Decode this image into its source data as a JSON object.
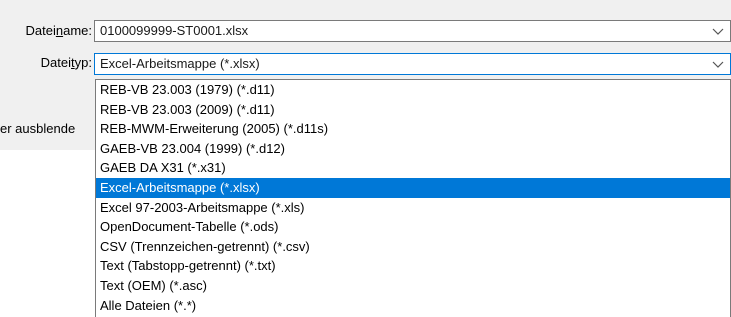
{
  "filename": {
    "label_prefix": "Datei",
    "label_accel": "n",
    "label_suffix": "ame:",
    "value": "0100099999-ST0001.xlsx"
  },
  "filetype": {
    "label_prefix": "Datei",
    "label_accel": "t",
    "label_suffix": "yp:",
    "selected": "Excel-Arbeitsmappe (*.xlsx)",
    "options": [
      "REB-VB 23.003 (1979) (*.d11)",
      "REB-VB 23.003 (2009) (*.d11)",
      "REB-MWM-Erweiterung (2005) (*.d11s)",
      "GAEB-VB 23.004 (1999) (*.d12)",
      "GAEB DA X31 (*.x31)",
      "Excel-Arbeitsmappe (*.xlsx)",
      "Excel 97-2003-Arbeitsmappe (*.xls)",
      "OpenDocument-Tabelle (*.ods)",
      "CSV (Trennzeichen-getrennt) (*.csv)",
      "Text (Tabstopp-getrennt) (*.txt)",
      "Text (OEM) (*.asc)",
      "Alle Dateien (*.*)"
    ],
    "selected_index": 5
  },
  "hide_folders_label": "er ausblende",
  "icons": {
    "dropdown": "chevron-down-icon"
  },
  "colors": {
    "dialog_bg": "#f0f0f0",
    "selection": "#0078d7",
    "border": "#7a7a7a"
  }
}
